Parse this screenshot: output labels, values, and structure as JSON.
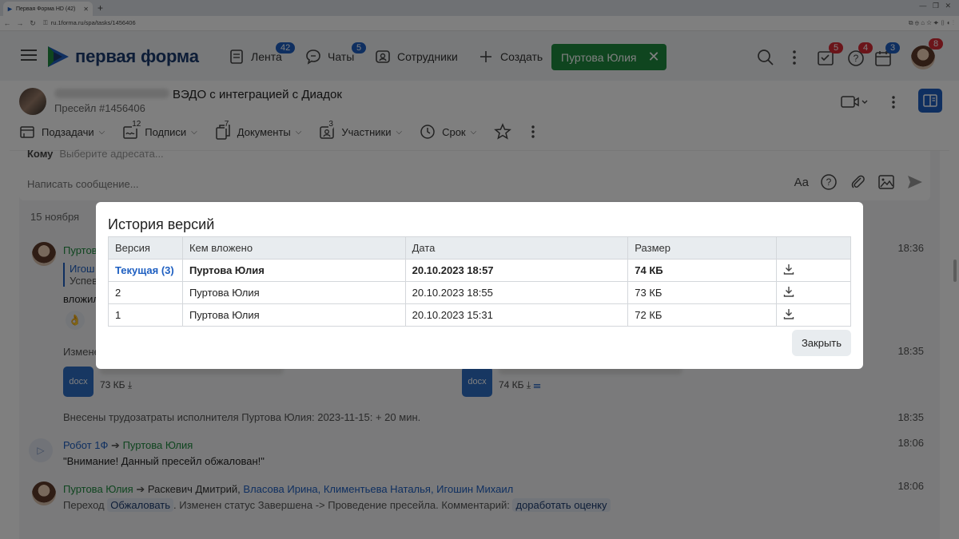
{
  "browser": {
    "tab_title": "Первая Форма HD (42)",
    "url": "ru.1forma.ru/spa/tasks/1456406"
  },
  "header": {
    "logo_text": "первая форма",
    "nav": [
      {
        "label": "Лента",
        "badge": "42"
      },
      {
        "label": "Чаты",
        "badge": "5"
      },
      {
        "label": "Сотрудники"
      },
      {
        "label": "Создать"
      }
    ],
    "user_chip": "Пуртова Юлия",
    "badges": {
      "tasks": "5",
      "help": "4",
      "calendar": "3",
      "avatar": "8"
    }
  },
  "task": {
    "title": "ВЭДО с интеграцией с Диадок",
    "subtitle": "Пресейл  #1456406",
    "toolbar": [
      {
        "label": "Подзадачи"
      },
      {
        "label": "Подписи",
        "count": "12"
      },
      {
        "label": "Документы",
        "count": "7"
      },
      {
        "label": "Участники",
        "count": "3"
      },
      {
        "label": "Срок"
      }
    ]
  },
  "compose": {
    "to_label": "Кому",
    "to_placeholder": "Выберите адресата...",
    "message_placeholder": "Написать сообщение...",
    "font_tool": "Aa"
  },
  "feed": {
    "date": "15 ноября",
    "entries": [
      {
        "author": "Пуртов",
        "quote_author": "Игош",
        "quote_text": "Успев",
        "text": "вложил",
        "time": "18:36"
      },
      {
        "text": "Измене",
        "time": "18:35"
      },
      {
        "file1_ext": "docx",
        "file1_size": "73 КБ",
        "file2_ext": "docx",
        "file2_size": "74 КБ"
      },
      {
        "text": "Внесены трудозатраты исполнителя Пуртова Юлия: 2023-11-15: + 20 мин.",
        "time": "18:35"
      },
      {
        "from": "Робот 1Ф",
        "to": "Пуртова Юлия",
        "text": "\"Внимание! Данный пресейл обжалован!\"",
        "time": "18:06"
      },
      {
        "from": "Пуртова Юлия",
        "to_plain": "Раскевич Дмитрий,",
        "to_links": "Власова Ирина, Климентьева Наталья, Игошин Михаил",
        "text_a": "Переход",
        "pill_a": "Обжаловать",
        "text_b": ". Изменен статус Завершена -> Проведение пресейла. Комментарий:",
        "pill_b": "доработать оценку",
        "time": "18:06"
      }
    ]
  },
  "modal": {
    "title": "История версий",
    "columns": [
      "Версия",
      "Кем вложено",
      "Дата",
      "Размер",
      ""
    ],
    "rows": [
      {
        "version": "Текущая (3)",
        "author": "Пуртова Юлия",
        "date": "20.10.2023 18:57",
        "size": "74 КБ"
      },
      {
        "version": "2",
        "author": "Пуртова Юлия",
        "date": "20.10.2023 18:55",
        "size": "73 КБ"
      },
      {
        "version": "1",
        "author": "Пуртова Юлия",
        "date": "20.10.2023 15:31",
        "size": "72 КБ"
      }
    ],
    "close_label": "Закрыть"
  },
  "colors": {
    "brand_green": "#1e8a3f",
    "brand_blue": "#1e5fc1",
    "badge_red": "#d62b35"
  }
}
